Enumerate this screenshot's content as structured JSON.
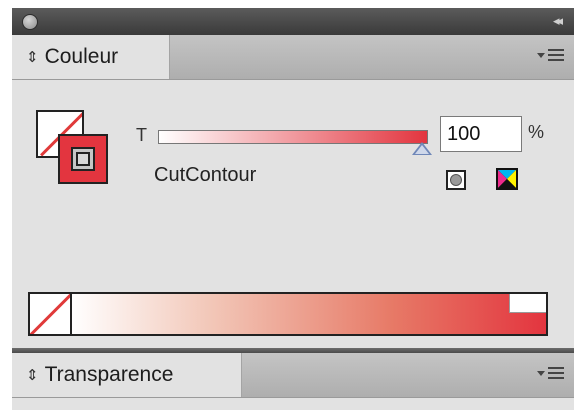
{
  "panel": {
    "collapse_label": "◂◂"
  },
  "color_panel": {
    "tab_label": "Couleur",
    "updown_label": "⇕",
    "tint_label": "T",
    "tint_value": "100",
    "tint_unit": "%",
    "tint_fraction": 1.0,
    "swatch_name": "CutContour",
    "accent_color": "#e3353f"
  },
  "transparency_panel": {
    "tab_label": "Transparence",
    "updown_label": "⇕"
  }
}
